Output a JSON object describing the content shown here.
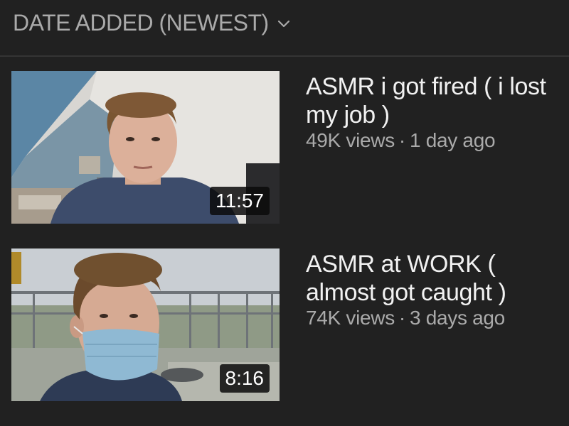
{
  "sort": {
    "label": "DATE ADDED (NEWEST)",
    "icon": "chevron-down-icon"
  },
  "videos": [
    {
      "title": "ASMR i got fired ( i lost my job )",
      "duration": "11:57",
      "views": "49K views",
      "separator": "·",
      "age": "1 day ago"
    },
    {
      "title": "ASMR at WORK ( almost got caught )",
      "duration": "8:16",
      "views": "74K views",
      "separator": "·",
      "age": "3 days ago"
    }
  ],
  "colors": {
    "background": "#212121",
    "secondary_text": "#aaaaaa",
    "primary_text": "#f1f1f1",
    "divider": "#353535"
  }
}
